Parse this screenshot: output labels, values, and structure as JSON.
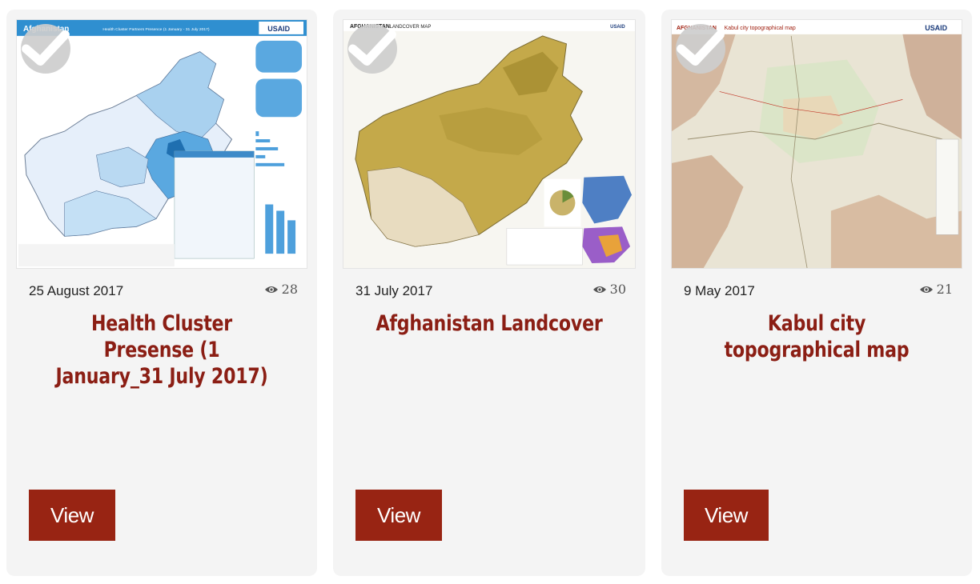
{
  "colors": {
    "card_bg": "#f4f4f4",
    "title": "#8b1e14",
    "button": "#982413",
    "check_badge": "#cdcdcd"
  },
  "cards": [
    {
      "date": "25 August 2017",
      "views": "28",
      "title": "Health Cluster Presense (1 January_31 July 2017)",
      "button_label": "View",
      "thumbnail": {
        "header_left": "Afghanistan",
        "header_right": "Health Cluster Partners Presence (1 January - 31 July 2017)",
        "logo": "USAID"
      }
    },
    {
      "date": "31 July 2017",
      "views": "30",
      "title": "Afghanistan Landcover",
      "button_label": "View",
      "thumbnail": {
        "header_left": "AFGHANISTAN",
        "header_right": "LANDCOVER MAP",
        "logo": "USAID"
      }
    },
    {
      "date": "9 May 2017",
      "views": "21",
      "title": "Kabul city topographical map",
      "button_label": "View",
      "thumbnail": {
        "header_left": "AFGHANISTAN",
        "header_right": "Kabul city topographical map",
        "logo": "USAID"
      }
    }
  ],
  "icons": {
    "check": "check-icon",
    "views": "eye-icon"
  }
}
